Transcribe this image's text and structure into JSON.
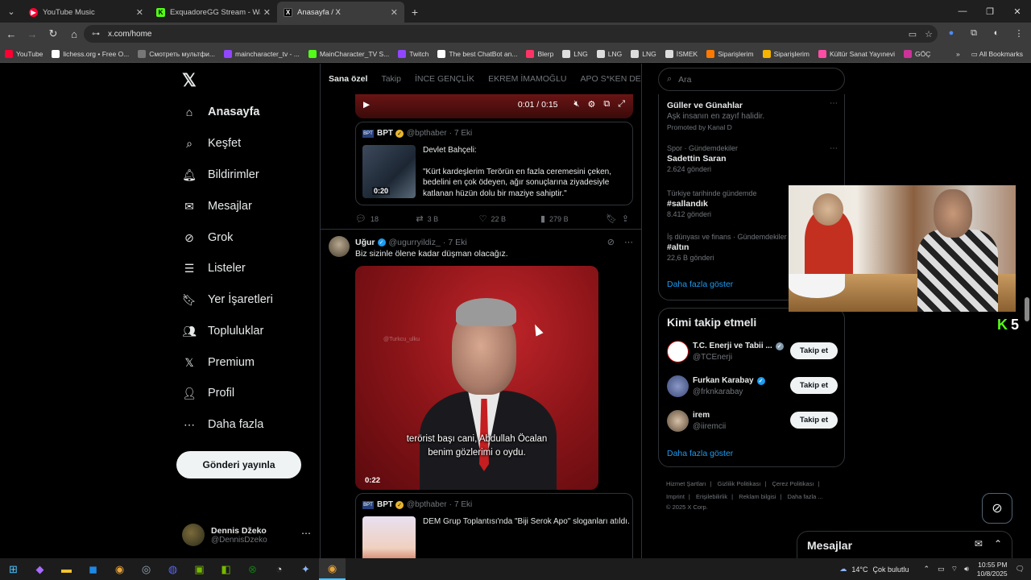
{
  "browser": {
    "tabs": [
      {
        "title": "YouTube Music",
        "favcolor": "#ff0033",
        "fav": "▶"
      },
      {
        "title": "ExquadoreGG Stream - Watch Liv",
        "favcolor": "#53fc18",
        "fav": "K"
      },
      {
        "title": "Anasayfa / X",
        "favcolor": "#000000",
        "fav": "X"
      }
    ],
    "url": "x.com/home",
    "bookmarks": [
      {
        "label": "YouTube",
        "color": "#ff0033"
      },
      {
        "label": "lichess.org • Free O...",
        "color": "#ffffff"
      },
      {
        "label": "Смотреть мультфи...",
        "color": "#777777"
      },
      {
        "label": "maincharacter_tv - ...",
        "color": "#9146ff"
      },
      {
        "label": "MainCharacter_TV S...",
        "color": "#53fc18"
      },
      {
        "label": "Twitch",
        "color": "#9146ff"
      },
      {
        "label": "The best ChatBot an...",
        "color": "#ffffff"
      },
      {
        "label": "Blerp",
        "color": "#ff3366"
      },
      {
        "label": "LNG",
        "color": "#dddddd"
      },
      {
        "label": "LNG",
        "color": "#dddddd"
      },
      {
        "label": "LNG",
        "color": "#dddddd"
      },
      {
        "label": "İSMEK",
        "color": "#dddddd"
      },
      {
        "label": "Siparişlerim",
        "color": "#ff7a00"
      },
      {
        "label": "Siparişlerim",
        "color": "#f4b400"
      },
      {
        "label": "Kültür Sanat Yayınevi",
        "color": "#ff4da6"
      },
      {
        "label": "GÖÇ",
        "color": "#cc3399"
      }
    ],
    "all_bookmarks": "All Bookmarks"
  },
  "nav": {
    "items": [
      {
        "label": "Anasayfa",
        "icon": "⌂",
        "name": "home"
      },
      {
        "label": "Keşfet",
        "icon": "⌕",
        "name": "explore"
      },
      {
        "label": "Bildirimler",
        "icon": "🔔︎",
        "name": "notifications"
      },
      {
        "label": "Mesajlar",
        "icon": "✉",
        "name": "messages"
      },
      {
        "label": "Grok",
        "icon": "⊘",
        "name": "grok"
      },
      {
        "label": "Listeler",
        "icon": "☰",
        "name": "lists"
      },
      {
        "label": "Yer İşaretleri",
        "icon": "🔖︎",
        "name": "bookmarks"
      },
      {
        "label": "Topluluklar",
        "icon": "👥︎",
        "name": "communities"
      },
      {
        "label": "Premium",
        "icon": "𝕏",
        "name": "premium"
      },
      {
        "label": "Profil",
        "icon": "👤︎",
        "name": "profile"
      },
      {
        "label": "Daha fazla",
        "icon": "⋯",
        "name": "more"
      }
    ],
    "post_button": "Gönderi yayınla",
    "user": {
      "name": "Dennis Džeko",
      "handle": "@DennisDzeko"
    }
  },
  "feed": {
    "tabs": [
      "Sana özel",
      "Takip",
      "İNCE GENÇLİK",
      "EKREM İMAMOĞLU",
      "APO S*KEN DE"
    ],
    "video_time": "0:01 / 0:15",
    "quote1": {
      "source": "BPT",
      "handle": "@bpthaber",
      "date": "7 Eki",
      "thumb_duration": "0:20",
      "text_line1": "Devlet Bahçeli:",
      "text_body": "\"Kürt kardeşlerim Terörün en fazla ceremesini çeken, bedelini en çok ödeyen, ağır sonuçlarına ziyadesiyle katlanan hüzün dolu bir maziye sahiptir.\""
    },
    "actions1": {
      "replies": "18",
      "reposts": "3 B",
      "likes": "22 B",
      "views": "279 B"
    },
    "post2": {
      "name": "Uğur",
      "handle": "@ugurryildiz_",
      "date": "7 Eki",
      "text": "Biz sizinle ölene kadar düşman olacağız.",
      "video_watermark": "@Turkcu_ulku",
      "subtitle_line1": "terörist başı cani, Abdullah Öcalan",
      "subtitle_line2": "benim gözlerimi o oydu.",
      "duration": "0:22"
    },
    "quote2": {
      "source": "BPT",
      "handle": "@bpthaber",
      "date": "7 Eki",
      "text": "DEM Grup Toplantısı'nda \"Biji Serok Apo\" sloganları atıldı."
    }
  },
  "sidebar": {
    "search_placeholder": "Ara",
    "trends": [
      {
        "meta": "",
        "title": "Güller ve Günahlar",
        "sub": "Aşk insanın en zayıf halidir.",
        "sub2": "Promoted by Kanal D"
      },
      {
        "meta": "Spor · Gündemdekiler",
        "title": "Sadettin Saran",
        "sub": "2.624 gönderi"
      },
      {
        "meta": "Türkiye tarihinde gündemde",
        "title": "#sallandık",
        "sub": "8.412 gönderi"
      },
      {
        "meta": "İş dünyası ve finans · Gündemdekiler",
        "title": "#altın",
        "sub": "22,6 B gönderi"
      }
    ],
    "show_more": "Daha fazla göster",
    "who_to_follow": "Kimi takip etmeli",
    "follow": [
      {
        "name": "T.C. Enerji ve Tabii ...",
        "handle": "@TCEnerji",
        "verif": "gray"
      },
      {
        "name": "Furkan Karabay",
        "handle": "@frknkarabay",
        "verif": "blue"
      },
      {
        "name": "irem",
        "handle": "@iiremcii",
        "verif": ""
      }
    ],
    "follow_button": "Takip et",
    "follow_show_more": "Daha fazla göster",
    "footer": [
      "Hizmet Şartları",
      "Gizlilik Politikası",
      "Çerez Politikası",
      "Imprint",
      "Erişilebilirlik",
      "Reklam bilgisi",
      "Daha fazla ...",
      "© 2025 X Corp."
    ]
  },
  "overlay": {
    "kick_count": "5",
    "messages_label": "Mesajlar"
  },
  "taskbar": {
    "temp": "14°C",
    "weather": "Çok bulutlu",
    "time": "10:55 PM",
    "date": "10/8/2025"
  }
}
